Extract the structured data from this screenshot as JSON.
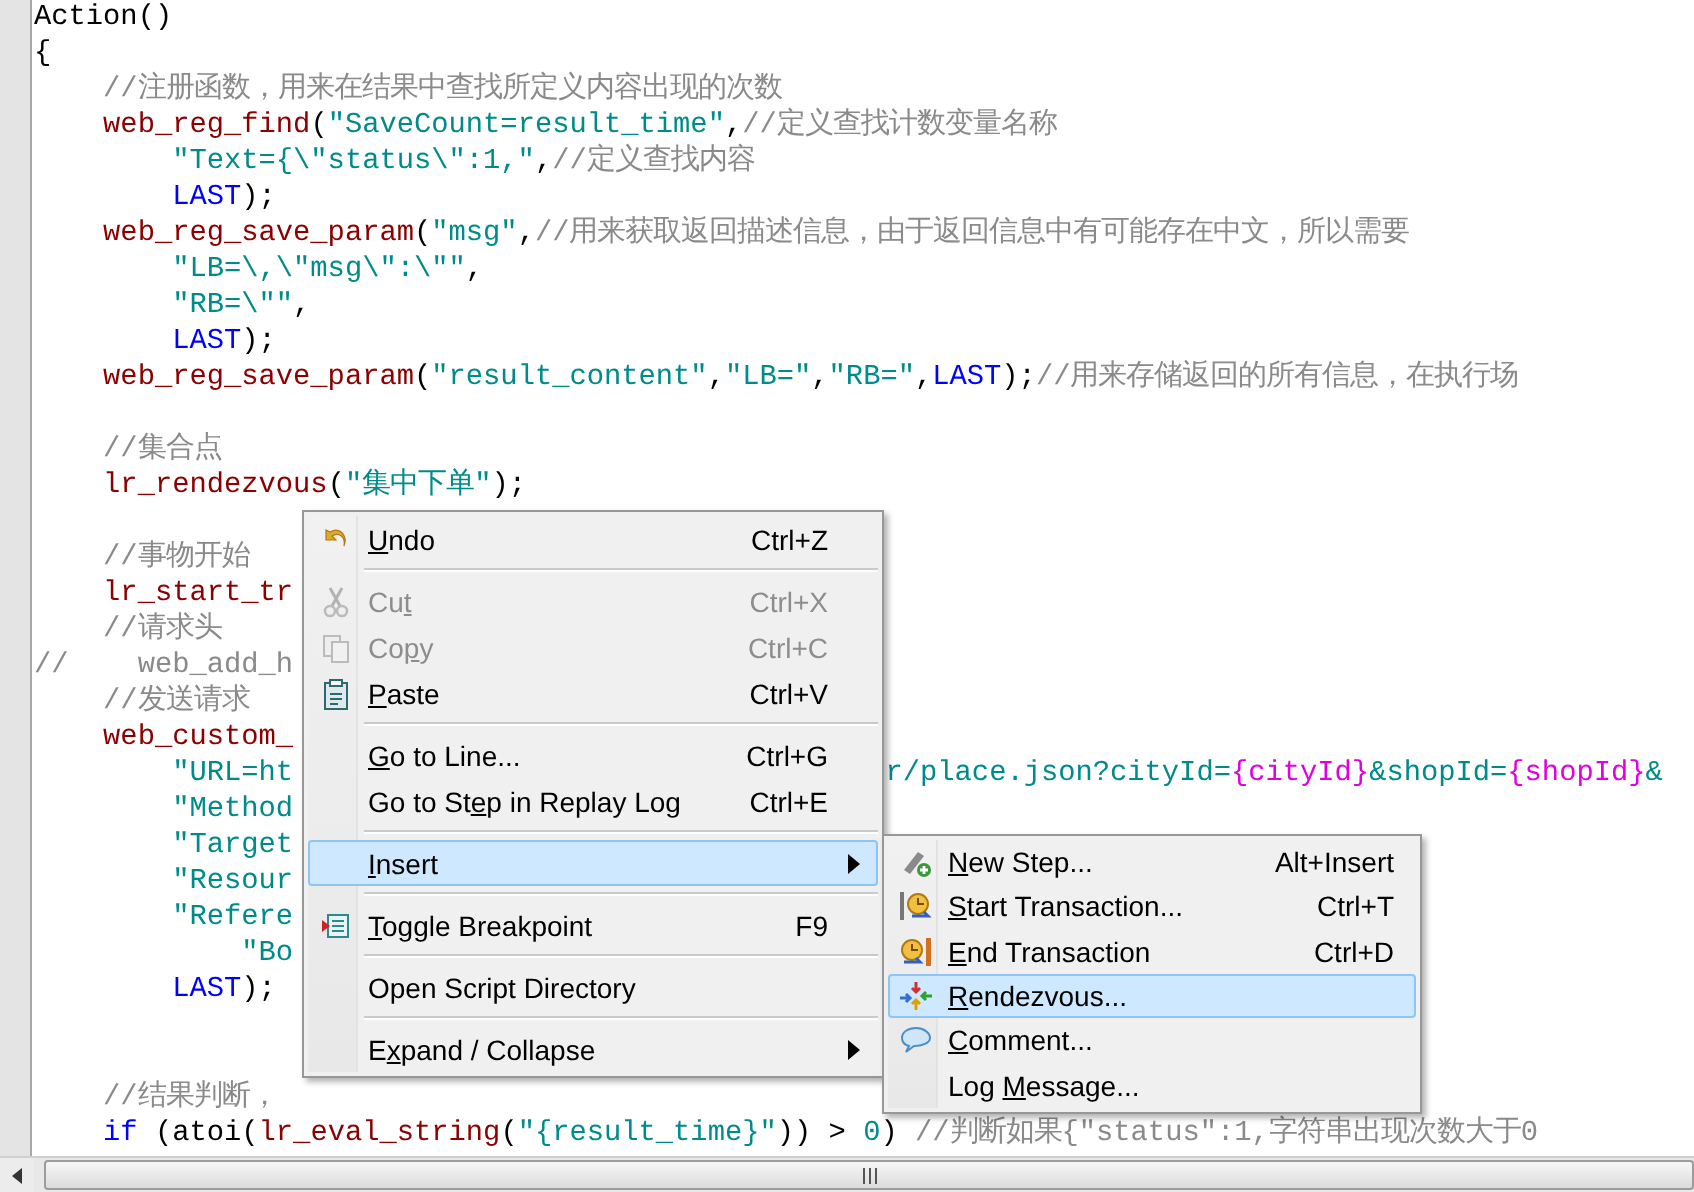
{
  "editor": {
    "lines": [
      {
        "tokens": [
          {
            "kind": "p",
            "t": "Action()"
          }
        ]
      },
      {
        "tokens": [
          {
            "kind": "p",
            "t": "{"
          }
        ]
      },
      {
        "tokens": [
          {
            "kind": "c",
            "t": "    //注册函数，用来在结果中查找所定义内容出现的次数"
          }
        ]
      },
      {
        "tokens": [
          {
            "kind": "f",
            "t": "    web_reg_find"
          },
          {
            "kind": "p",
            "t": "("
          },
          {
            "kind": "s",
            "t": "\"SaveCount=result_time\""
          },
          {
            "kind": "p",
            "t": ","
          },
          {
            "kind": "c",
            "t": "//定义查找计数变量名称"
          }
        ]
      },
      {
        "tokens": [
          {
            "kind": "s",
            "t": "        \"Text={\\\"status\\\":1,\""
          },
          {
            "kind": "p",
            "t": ","
          },
          {
            "kind": "c",
            "t": "//定义查找内容"
          }
        ]
      },
      {
        "tokens": [
          {
            "kind": "k",
            "t": "        LAST"
          },
          {
            "kind": "p",
            "t": ");"
          }
        ]
      },
      {
        "tokens": [
          {
            "kind": "f",
            "t": "    web_reg_save_param"
          },
          {
            "kind": "p",
            "t": "("
          },
          {
            "kind": "s",
            "t": "\"msg\""
          },
          {
            "kind": "p",
            "t": ","
          },
          {
            "kind": "c",
            "t": "//用来获取返回描述信息，由于返回信息中有可能存在中文，所以需要"
          }
        ]
      },
      {
        "tokens": [
          {
            "kind": "s",
            "t": "        \"LB=\\,\\\"msg\\\":\\\"\""
          },
          {
            "kind": "p",
            "t": ","
          }
        ]
      },
      {
        "tokens": [
          {
            "kind": "s",
            "t": "        \"RB=\\\"\""
          },
          {
            "kind": "p",
            "t": ","
          }
        ]
      },
      {
        "tokens": [
          {
            "kind": "k",
            "t": "        LAST"
          },
          {
            "kind": "p",
            "t": ");"
          }
        ]
      },
      {
        "tokens": [
          {
            "kind": "f",
            "t": "    web_reg_save_param"
          },
          {
            "kind": "p",
            "t": "("
          },
          {
            "kind": "s",
            "t": "\"result_content\""
          },
          {
            "kind": "p",
            "t": ","
          },
          {
            "kind": "s",
            "t": "\"LB=\""
          },
          {
            "kind": "p",
            "t": ","
          },
          {
            "kind": "s",
            "t": "\"RB=\""
          },
          {
            "kind": "p",
            "t": ","
          },
          {
            "kind": "k",
            "t": "LAST"
          },
          {
            "kind": "p",
            "t": ");"
          },
          {
            "kind": "c",
            "t": "//用来存储返回的所有信息，在执行场"
          }
        ]
      },
      {
        "kind": "blank"
      },
      {
        "tokens": [
          {
            "kind": "c",
            "t": "    //集合点"
          }
        ]
      },
      {
        "tokens": [
          {
            "kind": "f",
            "t": "    lr_rendezvous"
          },
          {
            "kind": "p",
            "t": "("
          },
          {
            "kind": "s",
            "t": "\"集中下单\""
          },
          {
            "kind": "p",
            "t": ");"
          }
        ]
      },
      {
        "kind": "blank"
      },
      {
        "tokens": [
          {
            "kind": "c",
            "t": "    //事物开始"
          }
        ]
      },
      {
        "tokens": [
          {
            "kind": "f",
            "t": "    lr_start_tr"
          }
        ]
      },
      {
        "tokens": [
          {
            "kind": "c",
            "t": "    //请求头"
          }
        ]
      },
      {
        "tokens": [
          {
            "kind": "c",
            "t": "//    web_add_h"
          }
        ]
      },
      {
        "tokens": [
          {
            "kind": "c",
            "t": "    //发送请求"
          }
        ]
      },
      {
        "tokens": [
          {
            "kind": "f",
            "t": "    web_custom_"
          }
        ]
      },
      {
        "tokens": [
          {
            "kind": "s",
            "t": "        \"URL=ht"
          }
        ],
        "continuation": [
          {
            "kind": "s",
            "t": "r/place.json?cityId="
          },
          {
            "kind": "v",
            "t": "{cityId}"
          },
          {
            "kind": "s",
            "t": "&shopId="
          },
          {
            "kind": "v",
            "t": "{shopId}"
          },
          {
            "kind": "s",
            "t": "&"
          }
        ]
      },
      {
        "tokens": [
          {
            "kind": "s",
            "t": "        \"Method"
          }
        ]
      },
      {
        "tokens": [
          {
            "kind": "s",
            "t": "        \"Target"
          }
        ]
      },
      {
        "tokens": [
          {
            "kind": "s",
            "t": "        \"Resour"
          }
        ]
      },
      {
        "tokens": [
          {
            "kind": "s",
            "t": "        \"Refere"
          }
        ]
      },
      {
        "tokens": [
          {
            "kind": "s",
            "t": "            \"Bo"
          }
        ]
      },
      {
        "tokens": [
          {
            "kind": "k",
            "t": "        LAST"
          },
          {
            "kind": "p",
            "t": ");"
          }
        ]
      },
      {
        "kind": "blank"
      },
      {
        "kind": "blank"
      },
      {
        "tokens": [
          {
            "kind": "c",
            "t": "    //结果判断，"
          }
        ]
      },
      {
        "tokens": [
          {
            "kind": "k",
            "t": "    if"
          },
          {
            "kind": "p",
            "t": " (atoi("
          },
          {
            "kind": "f",
            "t": "lr_eval_string"
          },
          {
            "kind": "p",
            "t": "("
          },
          {
            "kind": "s",
            "t": "\"{result_time}\""
          },
          {
            "kind": "p",
            "t": ")) > "
          },
          {
            "kind": "s",
            "t": "0"
          },
          {
            "kind": "p",
            "t": ") "
          },
          {
            "kind": "c",
            "t": "//判断如果{\"status\":1,字符串出现次数大于0"
          }
        ]
      }
    ]
  },
  "context_menu": {
    "items": [
      {
        "kind": "item",
        "mnemonic": "U",
        "label_end": "ndo",
        "shortcut": "Ctrl+Z",
        "disabled": false,
        "selected": false,
        "submenu": false
      },
      {
        "kind": "separator"
      },
      {
        "kind": "item",
        "label_start": "Cu",
        "mnemonic": "t",
        "shortcut": "Ctrl+X",
        "disabled": true,
        "selected": false,
        "submenu": false
      },
      {
        "kind": "item",
        "label_start": "Co",
        "mnemonic": "p",
        "label_end": "y",
        "shortcut": "Ctrl+C",
        "disabled": true,
        "selected": false,
        "submenu": false
      },
      {
        "kind": "item",
        "mnemonic": "P",
        "label_end": "aste",
        "shortcut": "Ctrl+V",
        "disabled": false,
        "selected": false,
        "submenu": false
      },
      {
        "kind": "separator"
      },
      {
        "kind": "item",
        "mnemonic": "G",
        "label_end": "o to Line...",
        "shortcut": "Ctrl+G",
        "disabled": false,
        "selected": false,
        "submenu": false
      },
      {
        "kind": "item",
        "label_start": "Go to St",
        "mnemonic": "e",
        "label_end": "p in Replay Log",
        "shortcut": "Ctrl+E",
        "disabled": false,
        "selected": false,
        "submenu": false
      },
      {
        "kind": "separator"
      },
      {
        "kind": "item",
        "mnemonic": "I",
        "label_end": "nsert",
        "disabled": false,
        "selected": true,
        "submenu": true
      },
      {
        "kind": "separator"
      },
      {
        "kind": "item",
        "mnemonic": "T",
        "label_end": "oggle Breakpoint",
        "shortcut": "F9",
        "disabled": false,
        "selected": false,
        "submenu": false
      },
      {
        "kind": "separator"
      },
      {
        "kind": "item",
        "label": "Open Script Directory",
        "disabled": false,
        "selected": false,
        "submenu": false
      },
      {
        "kind": "separator"
      },
      {
        "kind": "item",
        "label_start": "E",
        "mnemonic": "x",
        "label_end": "pand / Collapse",
        "disabled": false,
        "selected": false,
        "submenu": true
      }
    ]
  },
  "submenu": {
    "items": [
      {
        "kind": "item",
        "mnemonic": "N",
        "label_end": "ew Step...",
        "shortcut": "Alt+Insert",
        "disabled": false,
        "selected": false,
        "submenu": false
      },
      {
        "kind": "item",
        "mnemonic": "S",
        "label_end": "tart Transaction...",
        "shortcut": "Ctrl+T",
        "disabled": false,
        "selected": false,
        "submenu": false
      },
      {
        "kind": "item",
        "mnemonic": "E",
        "label_end": "nd Transaction",
        "shortcut": "Ctrl+D",
        "disabled": false,
        "selected": false,
        "submenu": false
      },
      {
        "kind": "item",
        "mnemonic": "R",
        "label_end": "endezvous...",
        "disabled": false,
        "selected": true,
        "submenu": false
      },
      {
        "kind": "item",
        "mnemonic": "C",
        "label_end": "omment...",
        "disabled": false,
        "selected": false,
        "submenu": false
      },
      {
        "kind": "item",
        "label_start": "Log ",
        "mnemonic": "M",
        "label_end": "essage...",
        "disabled": false,
        "selected": false,
        "submenu": false
      }
    ]
  }
}
